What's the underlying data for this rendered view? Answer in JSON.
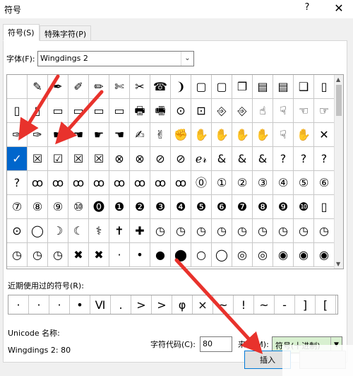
{
  "window": {
    "title": "符号",
    "help": "?",
    "close": "✕"
  },
  "tabs": [
    {
      "label": "符号(S)"
    },
    {
      "label": "特殊字符(P)"
    }
  ],
  "font": {
    "label": "字体(F):",
    "value": "Wingdings 2",
    "dropdown_icon": "chevron-down-icon"
  },
  "symbol_rows": [
    [
      "",
      "✎",
      "✒",
      "✐",
      "✏",
      "✄",
      "✂",
      "☎",
      "❩",
      "▢",
      "▢",
      "❐",
      "▤",
      "▤",
      "❑",
      "▯"
    ],
    [
      "▯",
      "▯",
      "▭",
      "▭",
      "▭",
      "▭",
      "🖶",
      "🖷",
      "⊙",
      "⊡",
      "⎆",
      "⎆",
      "☝",
      "☟",
      "☜",
      "☞"
    ],
    [
      "✑",
      "✑",
      "☛",
      "☚",
      "☛",
      "☚",
      "✍",
      "✌",
      "✊",
      "✋",
      "✋",
      "✋",
      "✋",
      "☟",
      "✋",
      "✕"
    ],
    [
      "✓",
      "☒",
      "☑",
      "☒",
      "☒",
      "⊗",
      "⊗",
      "⊘",
      "⊘",
      "ℯ𝓇",
      "&",
      "&",
      "&",
      "?",
      "?",
      "?"
    ],
    [
      "?",
      "ꝏ",
      "ꝏ",
      "ꝏ",
      "ꝏ",
      "ꝏ",
      "ꝏ",
      "ꝏ",
      "ꝏ",
      "⓪",
      "①",
      "②",
      "③",
      "④",
      "⑤",
      "⑥"
    ],
    [
      "⑦",
      "⑧",
      "⑨",
      "⑩",
      "⓿",
      "❶",
      "❷",
      "❸",
      "❹",
      "❺",
      "❻",
      "❼",
      "❽",
      "❾",
      "❿",
      "▯"
    ],
    [
      "⊙",
      "◯",
      "☽",
      "☾",
      "⚕",
      "✝",
      "✚",
      "◷",
      "◷",
      "◷",
      "◷",
      "◷",
      "◷",
      "◷",
      "◷",
      "◷"
    ],
    [
      "◷",
      "◷",
      "◷",
      "✖",
      "✖",
      "·",
      "•",
      "●",
      "⬤",
      "○",
      "◯",
      "◎",
      "◎",
      "◉",
      "◉",
      "◉"
    ]
  ],
  "selected_symbol": {
    "row": 3,
    "col": 0
  },
  "recent": {
    "label": "近期使用过的符号(R):",
    "symbols": [
      "·",
      "·",
      "·",
      "•",
      "Ⅵ",
      ".",
      ">",
      ">",
      "φ",
      "×",
      "~",
      "!",
      "~",
      "-",
      "]",
      "["
    ]
  },
  "unicode": {
    "label": "Unicode 名称:",
    "value": "Wingdings 2: 80"
  },
  "char_code": {
    "label": "字符代码(C):",
    "value": "80"
  },
  "from": {
    "label": "来自(M):",
    "value": "符号(十进制)"
  },
  "buttons": {
    "insert": "插入"
  },
  "colors": {
    "selected_cell": "#0066cc",
    "arrow": "#e8322c",
    "from_select_bg": "#d8f0d0"
  }
}
